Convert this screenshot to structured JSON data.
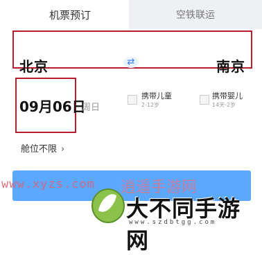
{
  "tabs": {
    "flight_booking": "机票预订",
    "air_rail": "空铁联运"
  },
  "route": {
    "from_city": "北京",
    "to_city": "南京",
    "swap_icon": "swap-arrows-icon"
  },
  "date": {
    "value": "09月06日",
    "weekday": "周日"
  },
  "passengers": {
    "child": {
      "label": "携带儿童",
      "age_range": "2-12岁"
    },
    "infant": {
      "label": "携带婴儿",
      "age_range": "14天-2岁"
    }
  },
  "cabin": {
    "label": "舱位不限",
    "chevron": "›"
  },
  "watermarks": {
    "url": "www.xyzs.com",
    "name": "逍遥手游网"
  },
  "site_logo": {
    "name": "大不同手游网",
    "url": "www.szdbtgg.com"
  },
  "colors": {
    "highlight_box": "#b81d2e",
    "button": "#5aa8ff",
    "accent": "#2f7cf6"
  }
}
